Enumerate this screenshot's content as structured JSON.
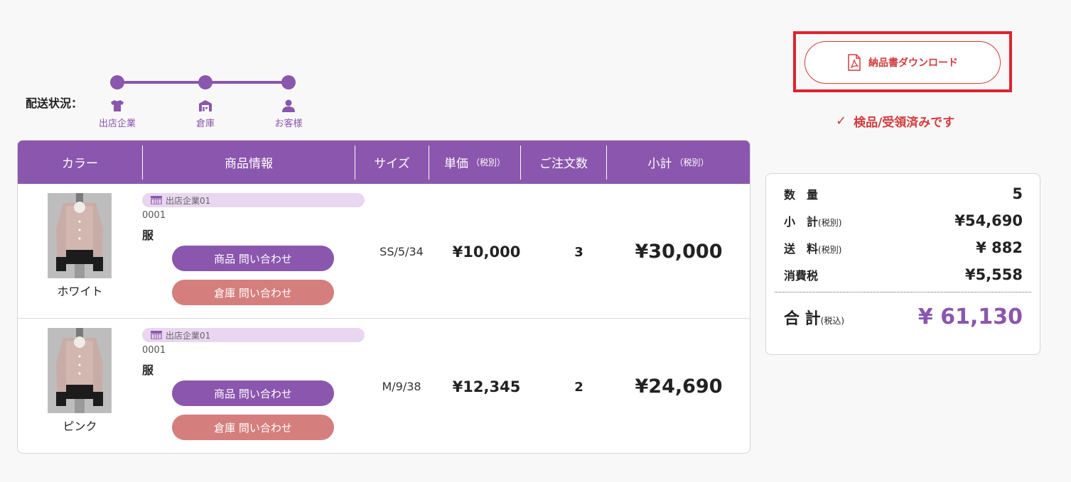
{
  "delivery": {
    "label": "配送状況：",
    "steps": [
      {
        "label": "出店企業",
        "icon": "tshirt-icon"
      },
      {
        "label": "倉庫",
        "icon": "warehouse-icon"
      },
      {
        "label": "お客様",
        "icon": "person-icon"
      }
    ]
  },
  "table": {
    "headers": {
      "color": "カラー",
      "product": "商品情報",
      "size": "サイズ",
      "unit_price": "単価",
      "unit_price_note": "（税別）",
      "qty": "ご注文数",
      "subtotal": "小計",
      "subtotal_note": "（税別）"
    },
    "rows": [
      {
        "color": "ホワイト",
        "store": "出店企業01",
        "code": "0001",
        "name": "服",
        "product_inquiry": "商品 問い合わせ",
        "warehouse_inquiry": "倉庫 問い合わせ",
        "size": "SS/5/34",
        "price": "¥10,000",
        "qty": "3",
        "subtotal": "¥30,000"
      },
      {
        "color": "ピンク",
        "store": "出店企業01",
        "code": "0001",
        "name": "服",
        "product_inquiry": "商品 問い合わせ",
        "warehouse_inquiry": "倉庫 問い合わせ",
        "size": "M/9/38",
        "price": "¥12,345",
        "qty": "2",
        "subtotal": "¥24,690"
      }
    ]
  },
  "download": {
    "label": "納品書ダウンロード",
    "icon": "pdf-icon"
  },
  "inspected": {
    "label": "検品/受領済みです",
    "icon": "check-icon"
  },
  "summary": {
    "quantity_label": "数　量",
    "quantity": "5",
    "subtotal_label": "小　計",
    "subtotal_note": "(税別)",
    "subtotal": "¥54,690",
    "shipping_label": "送　料",
    "shipping_note": "(税別)",
    "shipping": "¥ 882",
    "tax_label": "消費税",
    "tax": "¥5,558",
    "total_label": "合 計",
    "total_note": "(税込)",
    "total": "¥ 61,130"
  },
  "colors": {
    "accent": "#8b56ad",
    "warehouse_button": "#d47f7d",
    "alert_red": "#d23c3c",
    "badge_bg": "#e9d6f0"
  }
}
